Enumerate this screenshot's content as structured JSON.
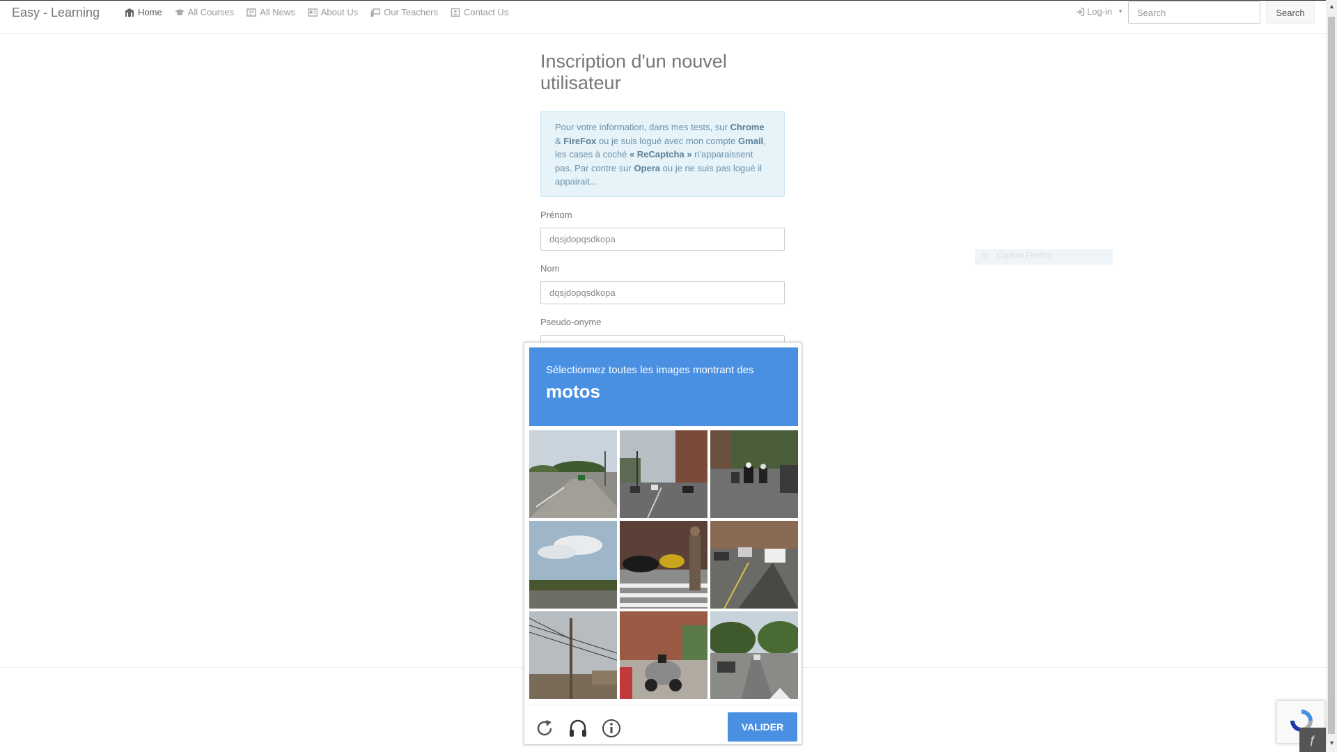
{
  "navbar": {
    "brand": "Easy - Learning",
    "items": [
      {
        "label": "Home",
        "icon": "building-icon",
        "active": true
      },
      {
        "label": "All Courses",
        "icon": "graduation-cap-icon"
      },
      {
        "label": "All News",
        "icon": "newspaper-icon"
      },
      {
        "label": "About Us",
        "icon": "id-card-icon"
      },
      {
        "label": "Our Teachers",
        "icon": "chalkboard-teacher-icon"
      },
      {
        "label": "Contact Us",
        "icon": "contact-card-icon"
      }
    ],
    "login_label": "Log-in",
    "search_placeholder": "Search",
    "search_button": "Search"
  },
  "form": {
    "title": "Inscription d'un nouvel utilisateur",
    "info": {
      "p1": "Pour votre information, dans mes tests, sur ",
      "b1": "Chrome",
      "p2": " & ",
      "b2": "FireFox",
      "p3": " ou je suis logué avec mon compte ",
      "b3": "Gmail",
      "p4": ", les cases à coché ",
      "b4": "« ReCaptcha »",
      "p5": " n'apparaissent pas. Par contre sur ",
      "b5": "Opera",
      "p6": " ou je ne suis pas logué il appairait..."
    },
    "fields": [
      {
        "label": "Prénom",
        "value": "dqsjdopqsdkopa"
      },
      {
        "label": "Nom",
        "value": "dqsjdopqsdkopa"
      },
      {
        "label": "Pseudo-onyme",
        "value": ""
      }
    ]
  },
  "capture_hint": "Capture Fenêtre",
  "recaptcha": {
    "instruction": "Sélectionnez toutes les images montrant des",
    "target": "motos",
    "verify_label": "VALIDER",
    "header_color": "#4a90e2",
    "tiles": [
      "road-intersection",
      "city-street",
      "motorcyclists-on-road",
      "sky-and-highway",
      "parked-motorcycles-crosswalk",
      "street-with-cars",
      "power-lines",
      "scooter-on-sidewalk",
      "residential-street"
    ]
  }
}
